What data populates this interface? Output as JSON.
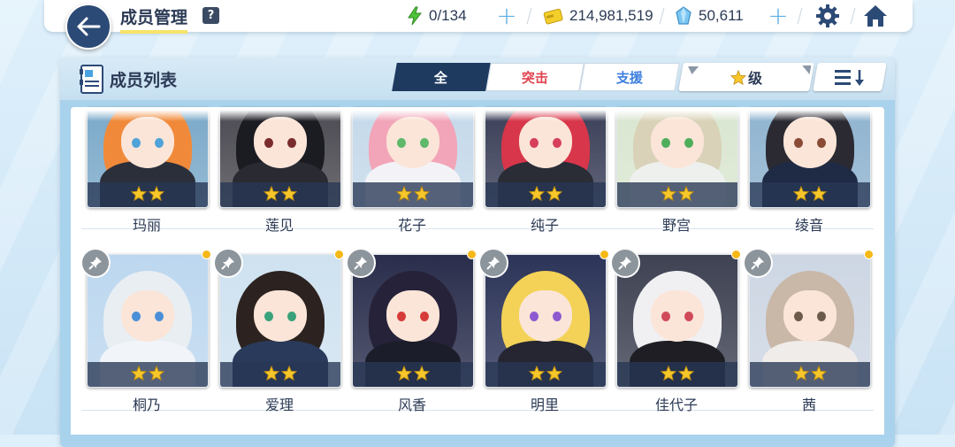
{
  "header": {
    "title": "成员管理",
    "help": "?",
    "ap": "0/134",
    "credits": "214,981,519",
    "gems": "50,611"
  },
  "panel": {
    "title": "成员列表",
    "tabs": [
      "全",
      "突击",
      "支援"
    ],
    "sort_label": "级"
  },
  "students": [
    {
      "name": "玛丽",
      "stars": 2
    },
    {
      "name": "莲见",
      "stars": 2
    },
    {
      "name": "花子",
      "stars": 2
    },
    {
      "name": "纯子",
      "stars": 2
    },
    {
      "name": "野宫",
      "stars": 2
    },
    {
      "name": "绫音",
      "stars": 2
    },
    {
      "name": "桐乃",
      "stars": 2
    },
    {
      "name": "爱理",
      "stars": 2
    },
    {
      "name": "风香",
      "stars": 2
    },
    {
      "name": "明里",
      "stars": 2
    },
    {
      "name": "佳代子",
      "stars": 2
    },
    {
      "name": "茜",
      "stars": 2
    }
  ],
  "colors": {
    "navy": "#1f3a5f",
    "strike_red": "#e0444f",
    "support_blue": "#3d7fe0",
    "star_gold": "#f6c62b",
    "new_dot": "#f5b817"
  }
}
